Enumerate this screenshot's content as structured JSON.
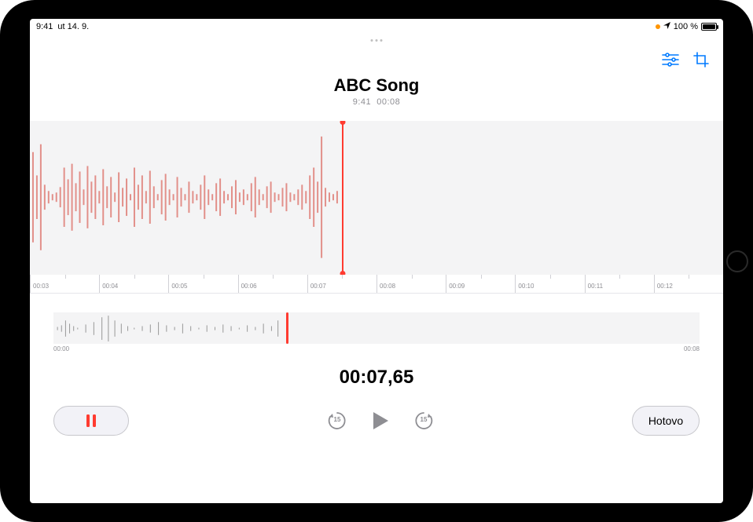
{
  "status": {
    "time": "9:41",
    "date": "ut 14. 9.",
    "battery_text": "100 %",
    "location_indicator": true,
    "recording_indicator": true
  },
  "toolbar": {
    "settings_icon": "sliders-icon",
    "crop_icon": "crop-icon"
  },
  "recording": {
    "title": "ABC Song",
    "meta_time": "9:41",
    "duration": "00:08"
  },
  "ruler_labels": [
    "00:03",
    "00:04",
    "00:05",
    "00:06",
    "00:07",
    "00:08",
    "00:09",
    "00:10",
    "00:11",
    "00:12"
  ],
  "overview": {
    "start_label": "00:00",
    "end_label": "00:08",
    "playhead_fraction": 0.36
  },
  "timecode": "00:07,65",
  "controls": {
    "pause_label": "pause",
    "skip_back_seconds": "15",
    "skip_forward_seconds": "15",
    "done_label": "Hotovo"
  },
  "colors": {
    "accent": "#ff3b30",
    "tint": "#007aff",
    "muted": "#8e8e93"
  }
}
